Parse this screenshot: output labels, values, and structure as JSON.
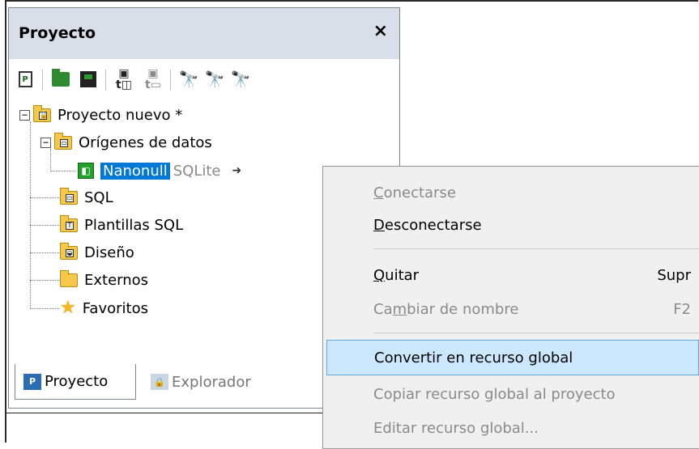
{
  "panel": {
    "title": "Proyecto",
    "close_glyph": "×"
  },
  "toolbar": {
    "icons": [
      "new-project-icon",
      "open-project-icon",
      "save-project-icon",
      "add-files-icon",
      "add-folder-icon",
      "find-icon",
      "find-next-icon",
      "find-prev-icon"
    ],
    "doc_letter": "P",
    "add_glyph_1": "P\nt□",
    "add_glyph_2": "P\nt□"
  },
  "tree": {
    "root": {
      "label": "Proyecto nuevo *",
      "expander": "⊟"
    },
    "data_sources": {
      "label": "Orígenes de datos",
      "expander": "⊟"
    },
    "connection": {
      "name": "Nanonull",
      "type": "SQLite",
      "arrow": "➜"
    },
    "sql": {
      "label": "SQL"
    },
    "sql_templates": {
      "label": "Plantillas SQL"
    },
    "design": {
      "label": "Diseño"
    },
    "external": {
      "label": "Externos"
    },
    "favorites": {
      "label": "Favoritos"
    }
  },
  "tabs": [
    {
      "label": "Proyecto",
      "active": true
    },
    {
      "label": "Explorador",
      "active": false
    }
  ],
  "context_menu": {
    "items": [
      {
        "pre": "",
        "acc": "C",
        "post": "onectarse",
        "shortcut": "",
        "disabled": true
      },
      {
        "pre": "",
        "acc": "D",
        "post": "esconectarse",
        "shortcut": "",
        "disabled": false
      },
      {
        "pre": "",
        "acc": "Q",
        "post": "uitar",
        "shortcut": "Supr",
        "disabled": false
      },
      {
        "pre": "Ca",
        "acc": "m",
        "post": "biar de nombre",
        "shortcut": "F2",
        "disabled": true
      },
      {
        "pre": "Convertir en recurso global",
        "acc": "",
        "post": "",
        "shortcut": "",
        "disabled": false,
        "highlighted": true
      },
      {
        "pre": "Copiar recurso global al proyecto",
        "acc": "",
        "post": "",
        "shortcut": "",
        "disabled": true
      },
      {
        "pre": "Editar recurso global...",
        "acc": "",
        "post": "",
        "shortcut": "",
        "disabled": true
      }
    ]
  },
  "colors": {
    "header_bg": "#d8dfe8",
    "selection": "#0078d7",
    "menu_highlight": "#cce8ff"
  }
}
